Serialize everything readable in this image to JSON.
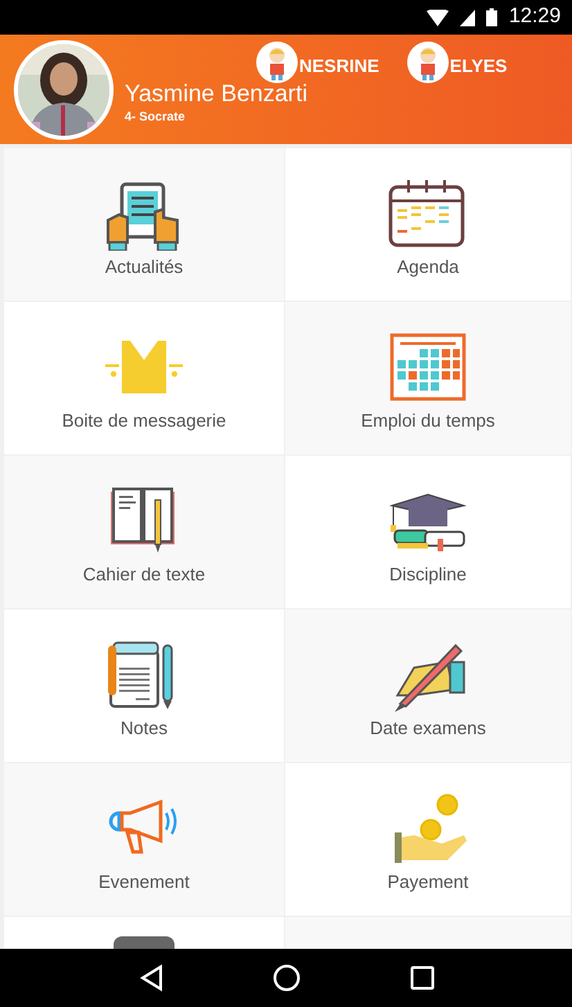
{
  "status_bar": {
    "time": "12:29"
  },
  "profile": {
    "name": "Yasmine Benzarti",
    "class": "4- Socrate"
  },
  "children": [
    {
      "name": "NESRINE"
    },
    {
      "name": "ELYES"
    }
  ],
  "tiles": [
    {
      "label": "Actualités"
    },
    {
      "label": "Agenda"
    },
    {
      "label": "Boite de messagerie"
    },
    {
      "label": "Emploi du temps"
    },
    {
      "label": "Cahier de texte"
    },
    {
      "label": "Discipline"
    },
    {
      "label": "Notes"
    },
    {
      "label": "Date examens"
    },
    {
      "label": "Evenement"
    },
    {
      "label": "Payement"
    }
  ]
}
